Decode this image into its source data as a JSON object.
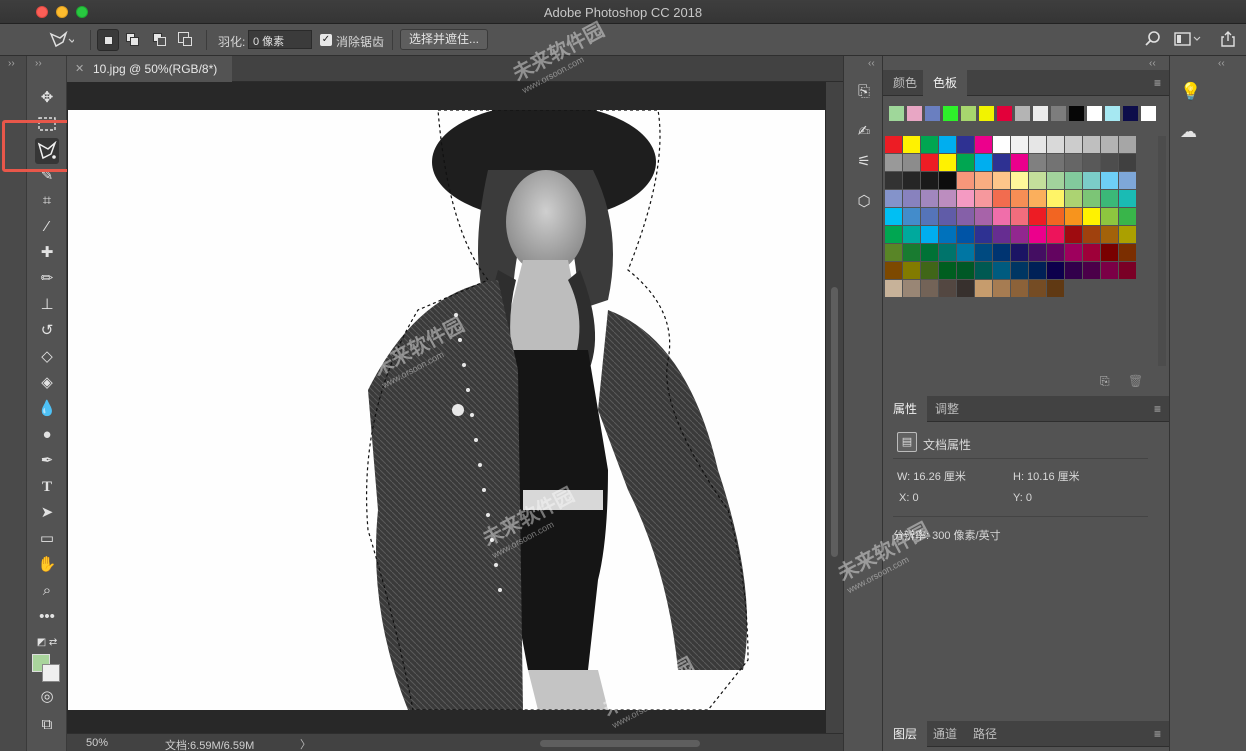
{
  "window": {
    "title": "Adobe Photoshop CC 2018"
  },
  "options_bar": {
    "feather_label": "羽化:",
    "feather_value": "0 像素",
    "anti_alias_label": "消除锯齿",
    "anti_alias_checked": true,
    "select_and_mask_label": "选择并遮住..."
  },
  "document": {
    "tab_label": "10.jpg @ 50%(RGB/8*)",
    "zoom": "50%",
    "doc_size": "文档:6.59M/6.59M"
  },
  "toolbar": {
    "selected_tool": "magnetic-lasso-tool",
    "foreground_color": "#a9d49c",
    "background_color": "#efefef"
  },
  "swatches_panel": {
    "tabs": [
      "颜色",
      "色板"
    ],
    "active_tab": "色板",
    "recent_colors": [
      "#9fd79a",
      "#e8a6c4",
      "#6a7fc0",
      "#2ef12a",
      "#a7d66e",
      "#f2f300",
      "#e3003a",
      "#b4b4b4",
      "#ececec",
      "#7d7d7d",
      "#060606",
      "#ffffff",
      "#a6e8f2",
      "#0d0d4a",
      "#ffffff"
    ]
  },
  "properties_panel": {
    "tabs": [
      "属性",
      "调整"
    ],
    "active_tab": "属性",
    "section_title": "文档属性",
    "width": "W: 16.26 厘米",
    "height": "H: 10.16 厘米",
    "x": "X: 0",
    "y": "Y: 0",
    "resolution": "分辨率: 300 像素/英寸"
  },
  "layers_panel": {
    "tabs": [
      "图层",
      "通道",
      "路径"
    ]
  },
  "watermarks": [
    {
      "text": "未来软件园",
      "url": "www.orsoon.com"
    }
  ],
  "annotation": {
    "highlight_color": "#e8574a"
  }
}
